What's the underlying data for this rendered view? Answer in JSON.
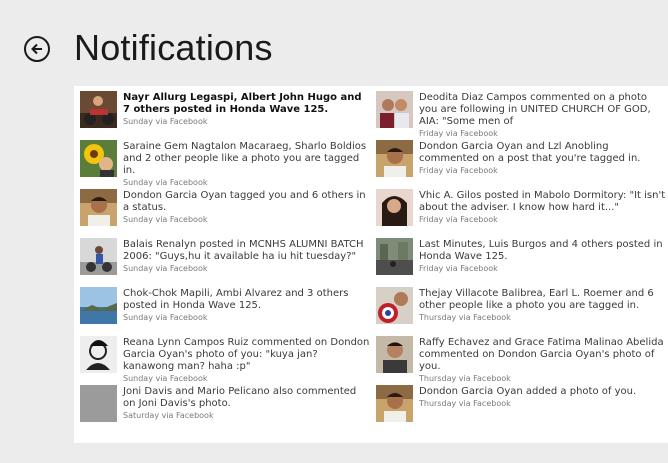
{
  "page_title": "Notifications",
  "colors": {
    "background": "#ececec",
    "panel": "#ffffff",
    "text": "#3a3a3a",
    "meta": "#7a7a7a"
  },
  "left_column": [
    {
      "message": "Nayr Allurg Legaspi, Albert John Hugo and 7 others posted in Honda Wave 125.",
      "meta": "Sunday via Facebook",
      "unread": true,
      "avatar": "photo-avatar-motorbike"
    },
    {
      "message": "Saraine Gem Nagtalon Macaraeg, Sharlo Boldios and 2 other people like a photo you are tagged in.",
      "meta": "Sunday via Facebook",
      "unread": false,
      "avatar": "photo-avatar-sunflower"
    },
    {
      "message": "Dondon Garcia Oyan tagged you and 6 others in a status.",
      "meta": "Sunday via Facebook",
      "unread": false,
      "avatar": "photo-avatar-man"
    },
    {
      "message": "Balais Renalyn posted in MCNHS ALUMNI BATCH 2006: \"Guys,hu it available ha iu hit tuesday?\"",
      "meta": "Sunday via Facebook",
      "unread": false,
      "avatar": "photo-avatar-bike-rider"
    },
    {
      "message": "Chok-Chok Mapili, Ambi Alvarez and 3 others posted in Honda Wave 125.",
      "meta": "Sunday via Facebook",
      "unread": false,
      "avatar": "photo-avatar-sea"
    },
    {
      "message": "Reana Lynn Campos Ruiz commented on Dondon Garcia Oyan's photo of you: \"kuya jan? kanawong man? haha :p\"",
      "meta": "Sunday via Facebook",
      "unread": false,
      "avatar": "photo-avatar-sketch"
    },
    {
      "message": "Joni Davis and Mario Pelicano also commented on Joni Davis's photo.",
      "meta": "Saturday via Facebook",
      "unread": false,
      "avatar": "placeholder-avatar"
    }
  ],
  "right_column": [
    {
      "message": "Deodita Diaz Campos commented on a photo you are following in UNITED CHURCH OF GOD, AIA: \"Some men of",
      "meta": "Friday via Facebook",
      "unread": false,
      "avatar": "photo-avatar-couple"
    },
    {
      "message": "Dondon Garcia Oyan and Lzl Anobling commented on a post that you're tagged in.",
      "meta": "Friday via Facebook",
      "unread": false,
      "avatar": "photo-avatar-man"
    },
    {
      "message": "Vhic A. Gilos posted in Mabolo Dormitory: \"It isn't about the adviser. I know how hard it...\"",
      "meta": "Friday via Facebook",
      "unread": false,
      "avatar": "photo-avatar-woman"
    },
    {
      "message": "Last Minutes, Luis Burgos and 4 others posted in Honda Wave 125.",
      "meta": "Friday via Facebook",
      "unread": false,
      "avatar": "photo-avatar-street"
    },
    {
      "message": "Thejay Villacote Balibrea, Earl L. Roemer and 6 other people like a photo you are tagged in.",
      "meta": "Thursday via Facebook",
      "unread": false,
      "avatar": "photo-avatar-shield"
    },
    {
      "message": "Raffy Echavez and Grace Fatima Malinao Abelida commented on Dondon Garcia Oyan's photo of you.",
      "meta": "Thursday via Facebook",
      "unread": false,
      "avatar": "photo-avatar-guy"
    },
    {
      "message": "Dondon Garcia Oyan added a photo of you.",
      "meta": "Thursday via Facebook",
      "unread": false,
      "avatar": "photo-avatar-man"
    }
  ]
}
